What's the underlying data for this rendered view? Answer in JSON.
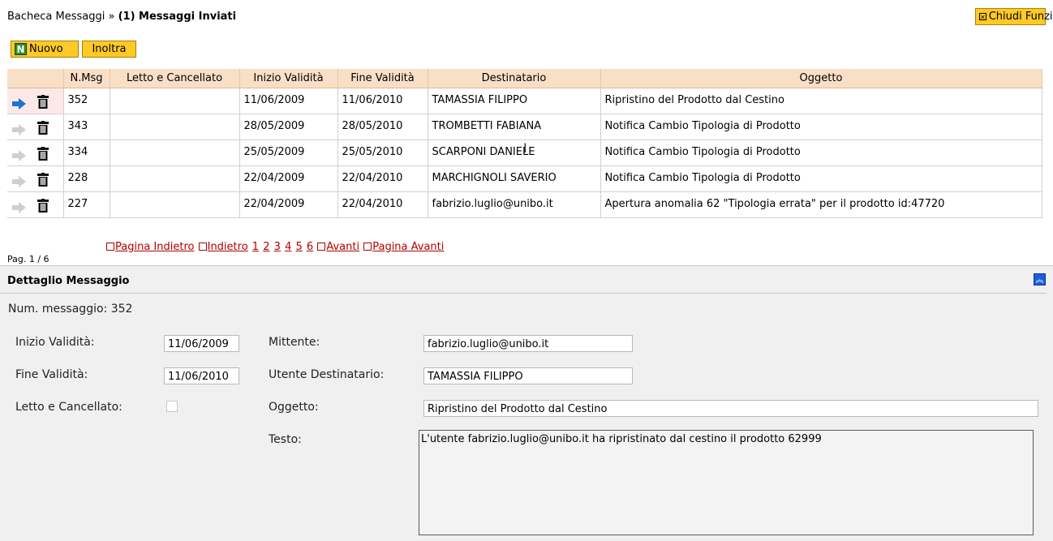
{
  "breadcrumb": {
    "parent": "Bacheca Messaggi",
    "separator": " » ",
    "current": "(1) Messaggi Inviati"
  },
  "toolbar": {
    "close_label": "Chiudi Funzione",
    "new_label": "Nuovo",
    "forward_label": "Inoltra"
  },
  "table": {
    "headers": [
      "",
      "N.Msg",
      "Letto e Cancellato",
      "Inizio Validità",
      "Fine Validità",
      "Destinatario",
      "Oggetto"
    ],
    "rows": [
      {
        "num": "352",
        "letto": "",
        "inizio": "11/06/2009",
        "fine": "11/06/2010",
        "dest": "TAMASSIA FILIPPO",
        "oggetto": "Ripristino del Prodotto dal Cestino",
        "selected": true
      },
      {
        "num": "343",
        "letto": "",
        "inizio": "28/05/2009",
        "fine": "28/05/2010",
        "dest": "TROMBETTI FABIANA",
        "oggetto": "Notifica Cambio Tipologia di Prodotto",
        "selected": false
      },
      {
        "num": "334",
        "letto": "",
        "inizio": "25/05/2009",
        "fine": "25/05/2010",
        "dest": "SCARPONI DANIELE",
        "oggetto": "Notifica Cambio Tipologia di Prodotto",
        "selected": false
      },
      {
        "num": "228",
        "letto": "",
        "inizio": "22/04/2009",
        "fine": "22/04/2010",
        "dest": "MARCHIGNOLI SAVERIO",
        "oggetto": "Notifica Cambio Tipologia di Prodotto",
        "selected": false
      },
      {
        "num": "227",
        "letto": "",
        "inizio": "22/04/2009",
        "fine": "22/04/2010",
        "dest": "fabrizio.luglio@unibo.it",
        "oggetto": "Apertura anomalia 62 \"Tipologia errata\" per il prodotto id:47720",
        "selected": false
      }
    ]
  },
  "pager": {
    "label": "Pag. 1 / 6",
    "first": "Pagina Indietro",
    "prev": "Indietro",
    "pages": [
      "1",
      "2",
      "3",
      "4",
      "5",
      "6"
    ],
    "next": "Avanti",
    "last": "Pagina Avanti"
  },
  "detail": {
    "title": "Dettaglio Messaggio",
    "collapse_icon": "double-chevron-up-icon",
    "num_label": "Num. messaggio: 352",
    "inizio_label": "Inizio Validità:",
    "inizio_value": "11/06/2009",
    "fine_label": "Fine Validità:",
    "fine_value": "11/06/2010",
    "letto_label": "Letto e Cancellato:",
    "letto_checked": false,
    "mittente_label": "Mittente:",
    "mittente_value": "fabrizio.luglio@unibo.it",
    "utente_label": "Utente Destinatario:",
    "utente_value": "TAMASSIA FILIPPO",
    "oggetto_label": "Oggetto:",
    "oggetto_value": "Ripristino del Prodotto dal Cestino",
    "testo_label": "Testo:",
    "testo_value": "L'utente fabrizio.luglio@unibo.it ha ripristinato dal cestino il prodotto 62999"
  },
  "colors": {
    "button_yellow": "#ffc926",
    "header_bg": "#f9dfc6",
    "link_red": "#b00000",
    "selected_arrow": "#1a73d9"
  }
}
